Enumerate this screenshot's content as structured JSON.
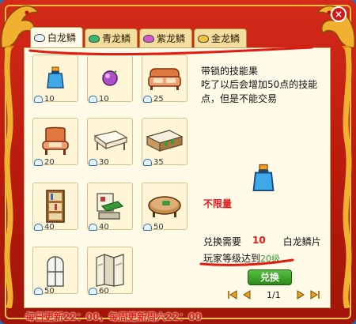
{
  "window": {
    "close_symbol": "×"
  },
  "tabs": [
    {
      "label": "白龙鳞",
      "gem_color": "#eef4ff",
      "active": true
    },
    {
      "label": "青龙鳞",
      "gem_color": "#34b86a",
      "active": false
    },
    {
      "label": "紫龙鳞",
      "gem_color": "#d05ad0",
      "active": false
    },
    {
      "label": "金龙鳞",
      "gem_color": "#f2c23a",
      "active": false
    }
  ],
  "items": [
    {
      "icon": "potion-bottle-icon",
      "price": "10"
    },
    {
      "icon": "purple-orb-icon",
      "price": "10"
    },
    {
      "icon": "sofa-icon",
      "price": "25"
    },
    {
      "icon": "armchair-icon",
      "price": "20"
    },
    {
      "icon": "white-table-icon",
      "price": "30"
    },
    {
      "icon": "counter-table-icon",
      "price": "35"
    },
    {
      "icon": "bookshelf-icon",
      "price": "40"
    },
    {
      "icon": "wall-shelf-icon",
      "price": "40"
    },
    {
      "icon": "coffee-table-icon",
      "price": "50"
    },
    {
      "icon": "window-icon",
      "price": "50"
    },
    {
      "icon": "folding-screen-icon",
      "price": "60"
    }
  ],
  "detail": {
    "title": "带锁的技能果",
    "description": "吃了以后会增加50点的技能点，但是不能交易",
    "limit": "不限量",
    "exchange_label": "兑换需要",
    "exchange_amount": "10",
    "exchange_currency": "白龙鳞片",
    "level_label": "玩家等级达到",
    "level_value": "20级",
    "exchange_button": "兑换"
  },
  "pager": {
    "text": "1/1"
  },
  "footer": {
    "text": "每日更新22：00，每周更新周六22：00"
  },
  "colors": {
    "frame_red": "#c8201a",
    "gold": "#f2c040",
    "panel_bg": "#fffbe8",
    "accent_red": "#e01c1c"
  }
}
